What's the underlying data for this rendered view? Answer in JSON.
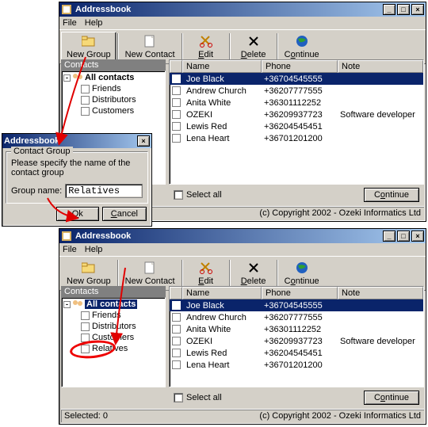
{
  "app": {
    "title": "Addressbook",
    "menus": {
      "file": "File",
      "help": "Help"
    },
    "toolbar": {
      "new_group": "New Group",
      "new_contact": "New Contact",
      "edit": "Edit",
      "delete": "Delete",
      "continue": "Continue"
    },
    "panel_contacts": "Contacts",
    "tree": {
      "root": "All contacts",
      "items_a": [
        "Friends",
        "Distributors",
        "Customers"
      ],
      "items_b": [
        "Friends",
        "Distributors",
        "Customers",
        "Relatives"
      ]
    },
    "columns": {
      "name": "Name",
      "phone": "Phone",
      "note": "Note"
    },
    "rows": [
      {
        "name": "Joe Black",
        "phone": "+36704545555",
        "note": ""
      },
      {
        "name": "Andrew Church",
        "phone": "+36207777555",
        "note": ""
      },
      {
        "name": "Anita White",
        "phone": "+36301112252",
        "note": ""
      },
      {
        "name": "OZEKI",
        "phone": "+36209937723",
        "note": "Software developer"
      },
      {
        "name": "Lewis Red",
        "phone": "+36204545451",
        "note": ""
      },
      {
        "name": "Lena Heart",
        "phone": "+36701201200",
        "note": ""
      }
    ],
    "select_all": "Select all",
    "continue_btn": "Continue",
    "copyright": "(c) Copyright 2002 - Ozeki Informatics Ltd",
    "status_selected": "Selected: 0"
  },
  "dialog": {
    "title": "Addressbook",
    "legend": "Contact Group",
    "prompt": "Please specify the name of the contact group",
    "label": "Group name:",
    "value": "Relatives",
    "ok": "Ok",
    "cancel": "Cancel"
  }
}
